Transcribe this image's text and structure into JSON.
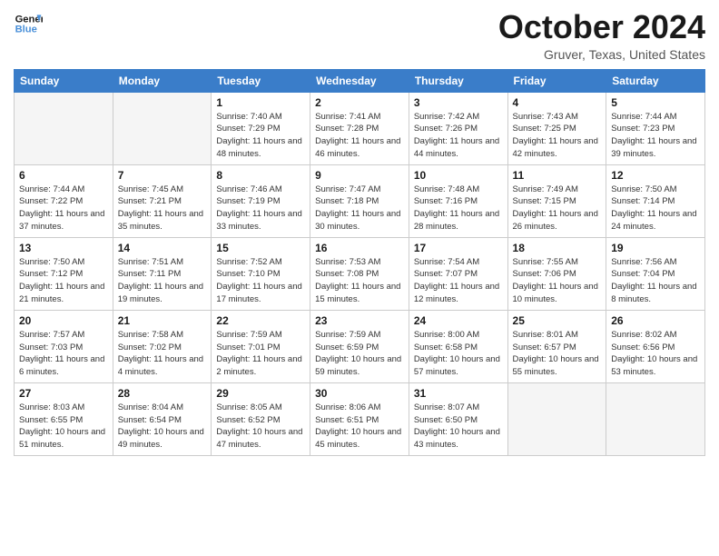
{
  "logo": {
    "line1": "General",
    "line2": "Blue"
  },
  "title": "October 2024",
  "location": "Gruver, Texas, United States",
  "days_of_week": [
    "Sunday",
    "Monday",
    "Tuesday",
    "Wednesday",
    "Thursday",
    "Friday",
    "Saturday"
  ],
  "weeks": [
    [
      {
        "num": "",
        "sunrise": "",
        "sunset": "",
        "daylight": ""
      },
      {
        "num": "",
        "sunrise": "",
        "sunset": "",
        "daylight": ""
      },
      {
        "num": "1",
        "sunrise": "Sunrise: 7:40 AM",
        "sunset": "Sunset: 7:29 PM",
        "daylight": "Daylight: 11 hours and 48 minutes."
      },
      {
        "num": "2",
        "sunrise": "Sunrise: 7:41 AM",
        "sunset": "Sunset: 7:28 PM",
        "daylight": "Daylight: 11 hours and 46 minutes."
      },
      {
        "num": "3",
        "sunrise": "Sunrise: 7:42 AM",
        "sunset": "Sunset: 7:26 PM",
        "daylight": "Daylight: 11 hours and 44 minutes."
      },
      {
        "num": "4",
        "sunrise": "Sunrise: 7:43 AM",
        "sunset": "Sunset: 7:25 PM",
        "daylight": "Daylight: 11 hours and 42 minutes."
      },
      {
        "num": "5",
        "sunrise": "Sunrise: 7:44 AM",
        "sunset": "Sunset: 7:23 PM",
        "daylight": "Daylight: 11 hours and 39 minutes."
      }
    ],
    [
      {
        "num": "6",
        "sunrise": "Sunrise: 7:44 AM",
        "sunset": "Sunset: 7:22 PM",
        "daylight": "Daylight: 11 hours and 37 minutes."
      },
      {
        "num": "7",
        "sunrise": "Sunrise: 7:45 AM",
        "sunset": "Sunset: 7:21 PM",
        "daylight": "Daylight: 11 hours and 35 minutes."
      },
      {
        "num": "8",
        "sunrise": "Sunrise: 7:46 AM",
        "sunset": "Sunset: 7:19 PM",
        "daylight": "Daylight: 11 hours and 33 minutes."
      },
      {
        "num": "9",
        "sunrise": "Sunrise: 7:47 AM",
        "sunset": "Sunset: 7:18 PM",
        "daylight": "Daylight: 11 hours and 30 minutes."
      },
      {
        "num": "10",
        "sunrise": "Sunrise: 7:48 AM",
        "sunset": "Sunset: 7:16 PM",
        "daylight": "Daylight: 11 hours and 28 minutes."
      },
      {
        "num": "11",
        "sunrise": "Sunrise: 7:49 AM",
        "sunset": "Sunset: 7:15 PM",
        "daylight": "Daylight: 11 hours and 26 minutes."
      },
      {
        "num": "12",
        "sunrise": "Sunrise: 7:50 AM",
        "sunset": "Sunset: 7:14 PM",
        "daylight": "Daylight: 11 hours and 24 minutes."
      }
    ],
    [
      {
        "num": "13",
        "sunrise": "Sunrise: 7:50 AM",
        "sunset": "Sunset: 7:12 PM",
        "daylight": "Daylight: 11 hours and 21 minutes."
      },
      {
        "num": "14",
        "sunrise": "Sunrise: 7:51 AM",
        "sunset": "Sunset: 7:11 PM",
        "daylight": "Daylight: 11 hours and 19 minutes."
      },
      {
        "num": "15",
        "sunrise": "Sunrise: 7:52 AM",
        "sunset": "Sunset: 7:10 PM",
        "daylight": "Daylight: 11 hours and 17 minutes."
      },
      {
        "num": "16",
        "sunrise": "Sunrise: 7:53 AM",
        "sunset": "Sunset: 7:08 PM",
        "daylight": "Daylight: 11 hours and 15 minutes."
      },
      {
        "num": "17",
        "sunrise": "Sunrise: 7:54 AM",
        "sunset": "Sunset: 7:07 PM",
        "daylight": "Daylight: 11 hours and 12 minutes."
      },
      {
        "num": "18",
        "sunrise": "Sunrise: 7:55 AM",
        "sunset": "Sunset: 7:06 PM",
        "daylight": "Daylight: 11 hours and 10 minutes."
      },
      {
        "num": "19",
        "sunrise": "Sunrise: 7:56 AM",
        "sunset": "Sunset: 7:04 PM",
        "daylight": "Daylight: 11 hours and 8 minutes."
      }
    ],
    [
      {
        "num": "20",
        "sunrise": "Sunrise: 7:57 AM",
        "sunset": "Sunset: 7:03 PM",
        "daylight": "Daylight: 11 hours and 6 minutes."
      },
      {
        "num": "21",
        "sunrise": "Sunrise: 7:58 AM",
        "sunset": "Sunset: 7:02 PM",
        "daylight": "Daylight: 11 hours and 4 minutes."
      },
      {
        "num": "22",
        "sunrise": "Sunrise: 7:59 AM",
        "sunset": "Sunset: 7:01 PM",
        "daylight": "Daylight: 11 hours and 2 minutes."
      },
      {
        "num": "23",
        "sunrise": "Sunrise: 7:59 AM",
        "sunset": "Sunset: 6:59 PM",
        "daylight": "Daylight: 10 hours and 59 minutes."
      },
      {
        "num": "24",
        "sunrise": "Sunrise: 8:00 AM",
        "sunset": "Sunset: 6:58 PM",
        "daylight": "Daylight: 10 hours and 57 minutes."
      },
      {
        "num": "25",
        "sunrise": "Sunrise: 8:01 AM",
        "sunset": "Sunset: 6:57 PM",
        "daylight": "Daylight: 10 hours and 55 minutes."
      },
      {
        "num": "26",
        "sunrise": "Sunrise: 8:02 AM",
        "sunset": "Sunset: 6:56 PM",
        "daylight": "Daylight: 10 hours and 53 minutes."
      }
    ],
    [
      {
        "num": "27",
        "sunrise": "Sunrise: 8:03 AM",
        "sunset": "Sunset: 6:55 PM",
        "daylight": "Daylight: 10 hours and 51 minutes."
      },
      {
        "num": "28",
        "sunrise": "Sunrise: 8:04 AM",
        "sunset": "Sunset: 6:54 PM",
        "daylight": "Daylight: 10 hours and 49 minutes."
      },
      {
        "num": "29",
        "sunrise": "Sunrise: 8:05 AM",
        "sunset": "Sunset: 6:52 PM",
        "daylight": "Daylight: 10 hours and 47 minutes."
      },
      {
        "num": "30",
        "sunrise": "Sunrise: 8:06 AM",
        "sunset": "Sunset: 6:51 PM",
        "daylight": "Daylight: 10 hours and 45 minutes."
      },
      {
        "num": "31",
        "sunrise": "Sunrise: 8:07 AM",
        "sunset": "Sunset: 6:50 PM",
        "daylight": "Daylight: 10 hours and 43 minutes."
      },
      {
        "num": "",
        "sunrise": "",
        "sunset": "",
        "daylight": ""
      },
      {
        "num": "",
        "sunrise": "",
        "sunset": "",
        "daylight": ""
      }
    ]
  ]
}
